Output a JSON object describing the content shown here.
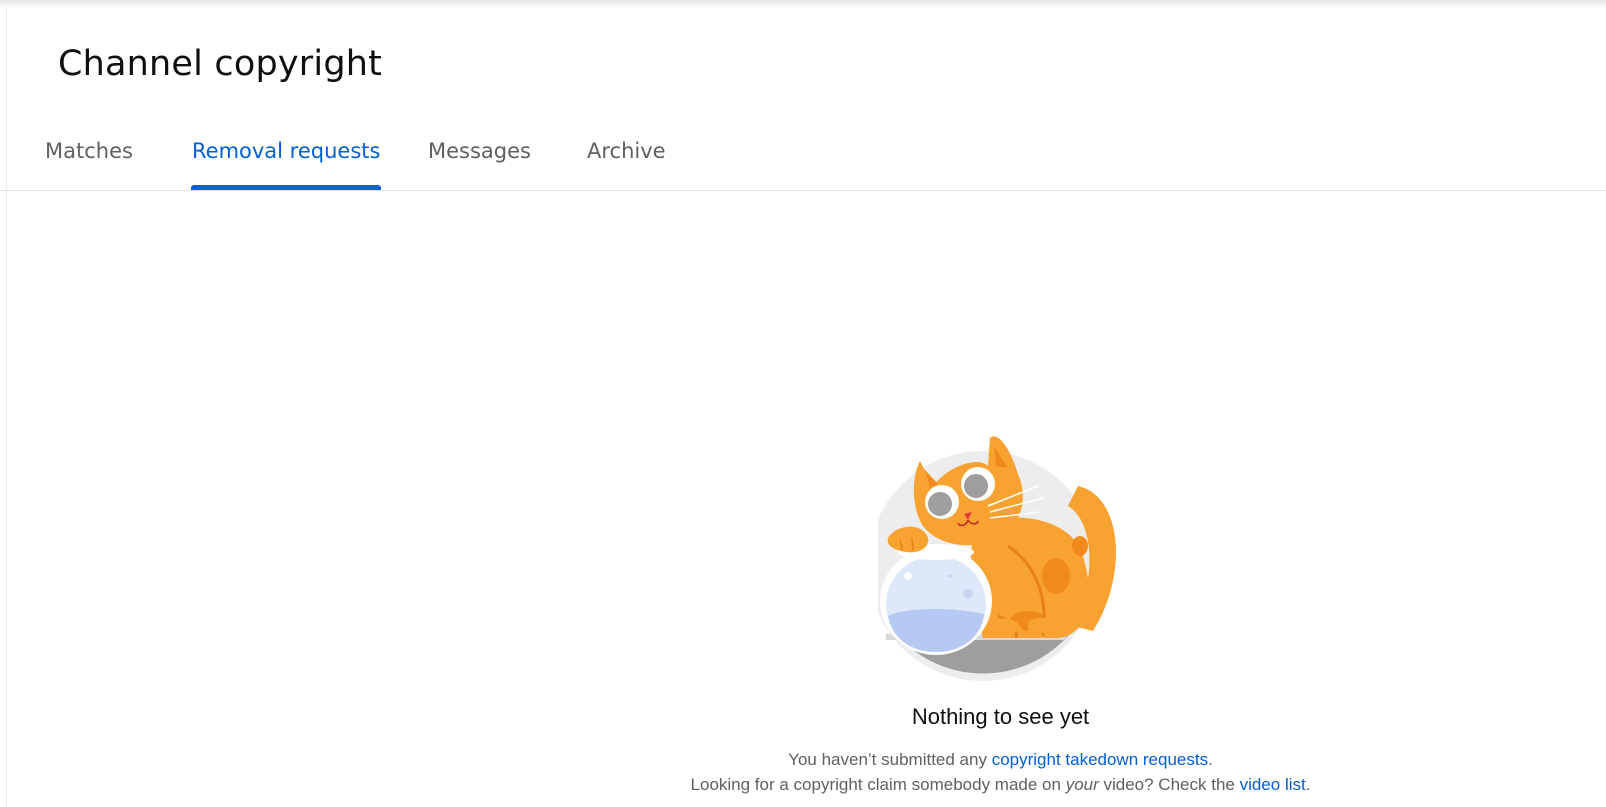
{
  "page": {
    "title": "Channel copyright"
  },
  "tabs": [
    {
      "label": "Matches",
      "active": false
    },
    {
      "label": "Removal requests",
      "active": true
    },
    {
      "label": "Messages",
      "active": false
    },
    {
      "label": "Archive",
      "active": false
    }
  ],
  "empty_state": {
    "illustration_icon": "cat-with-fishbowl-illustration",
    "title": "Nothing to see yet",
    "line1_prefix": "You haven’t submitted any ",
    "line1_link": "copyright takedown requests",
    "line1_suffix": ".",
    "line2_prefix": "Looking for a copyright claim somebody made on ",
    "line2_emphasis": "your",
    "line2_middle": " video? Check the ",
    "line2_link": "video list",
    "line2_suffix": "."
  },
  "colors": {
    "accent": "#065fd4",
    "text_primary": "#0f0f0f",
    "text_secondary": "#606060",
    "cat_orange": "#f8a331"
  }
}
